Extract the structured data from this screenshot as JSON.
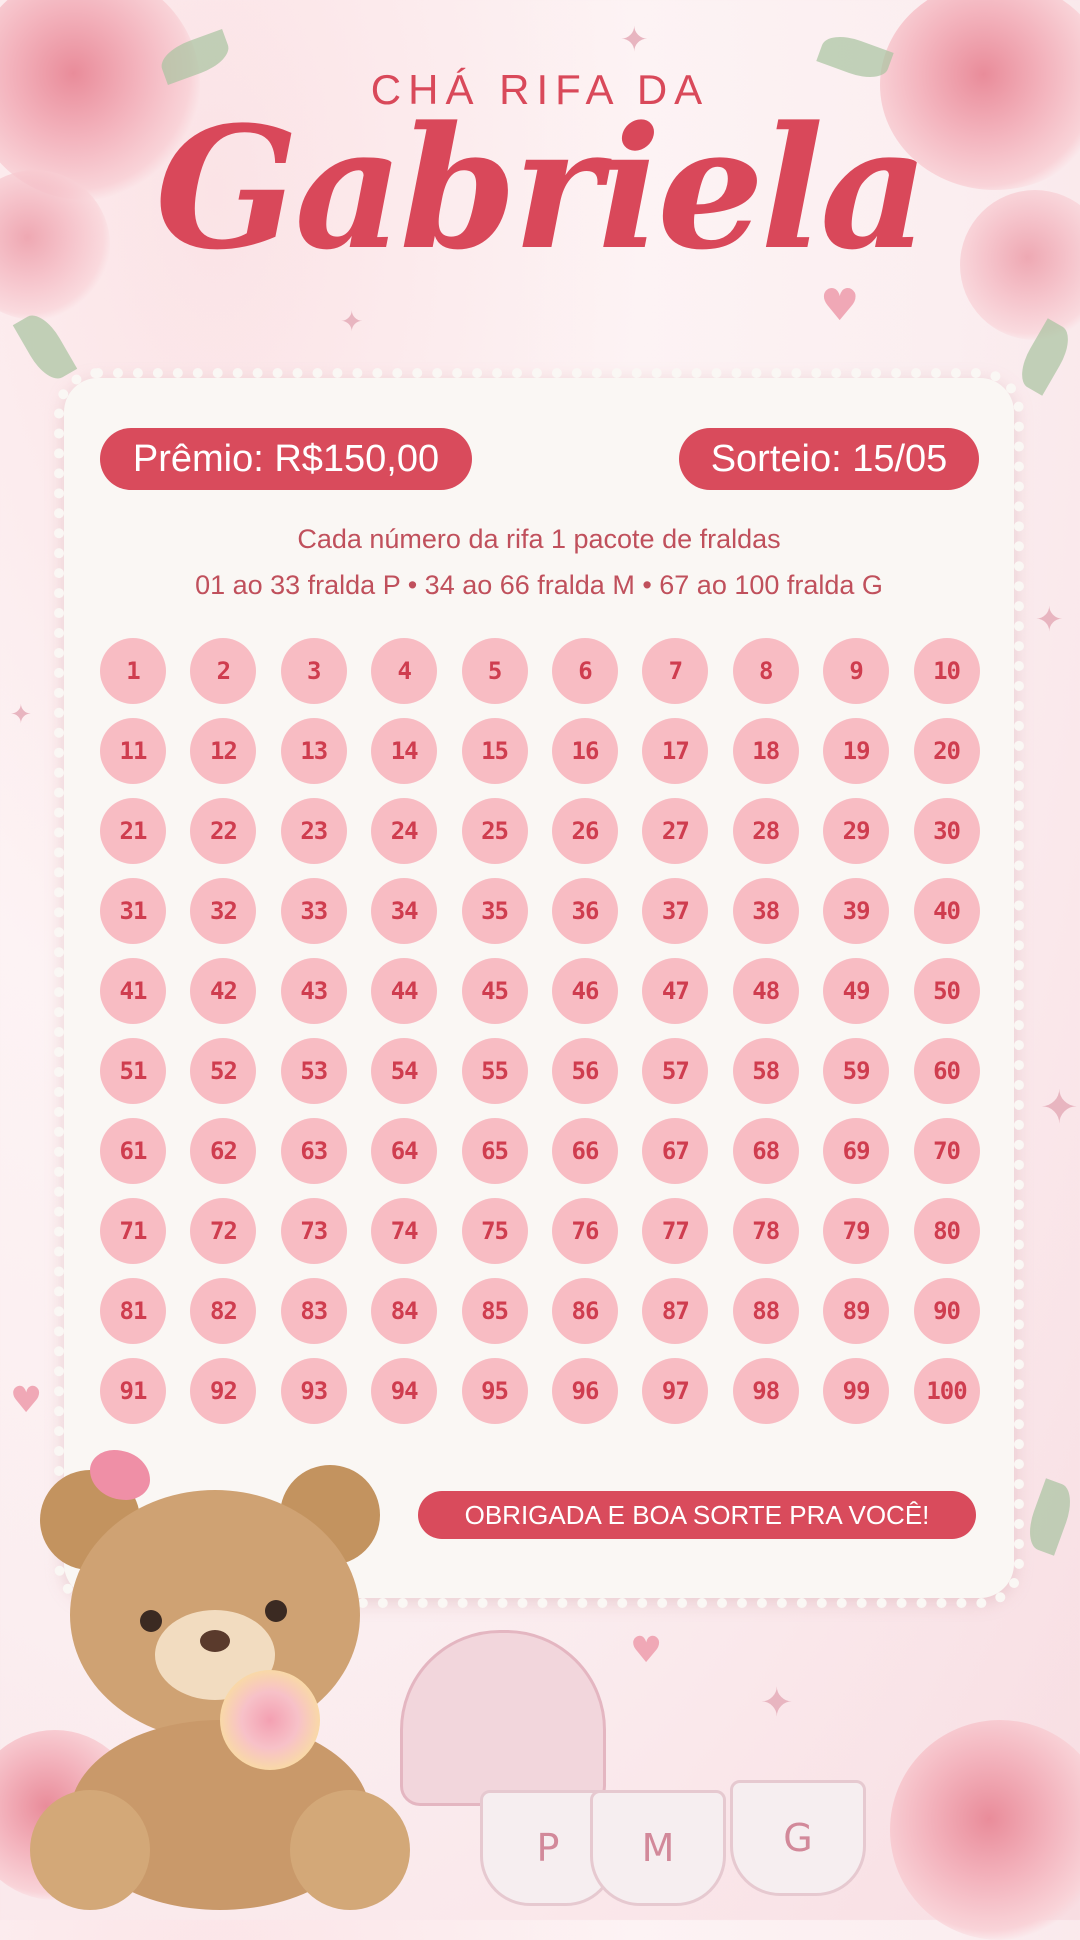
{
  "header": {
    "subtitle": "CHÁ RIFA DA",
    "name": "Gabriela"
  },
  "card": {
    "prize_label": "Prêmio: R$150,00",
    "draw_label": "Sorteio: 15/05",
    "info_line1": "Cada número da rifa 1 pacote de fraldas",
    "info_line2": "01 ao 33 fralda P •  34 ao 66 fralda M  • 67 ao 100 fralda G",
    "numbers": [
      "1",
      "2",
      "3",
      "4",
      "5",
      "6",
      "7",
      "8",
      "9",
      "10",
      "11",
      "12",
      "13",
      "14",
      "15",
      "16",
      "17",
      "18",
      "19",
      "20",
      "21",
      "22",
      "23",
      "24",
      "25",
      "26",
      "27",
      "28",
      "29",
      "30",
      "31",
      "32",
      "33",
      "34",
      "35",
      "36",
      "37",
      "38",
      "39",
      "40",
      "41",
      "42",
      "43",
      "44",
      "45",
      "46",
      "47",
      "48",
      "49",
      "50",
      "51",
      "52",
      "53",
      "54",
      "55",
      "56",
      "57",
      "58",
      "59",
      "60",
      "61",
      "62",
      "63",
      "64",
      "65",
      "66",
      "67",
      "68",
      "69",
      "70",
      "71",
      "72",
      "73",
      "74",
      "75",
      "76",
      "77",
      "78",
      "79",
      "80",
      "81",
      "82",
      "83",
      "84",
      "85",
      "86",
      "87",
      "88",
      "89",
      "90",
      "91",
      "92",
      "93",
      "94",
      "95",
      "96",
      "97",
      "98",
      "99",
      "100"
    ],
    "thanks": "OBRIGADA E BOA SORTE PRA VOCÊ!"
  },
  "decor": {
    "diapers": [
      "P",
      "M",
      "G"
    ],
    "colors": {
      "accent": "#d94b5c",
      "circle": "#f8bcc3",
      "number": "#cf3d4f"
    }
  }
}
